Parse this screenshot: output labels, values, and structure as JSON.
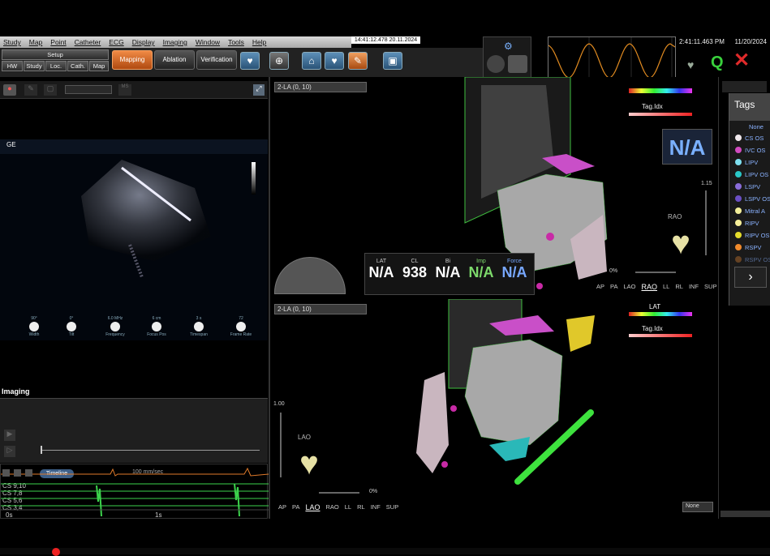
{
  "menu": [
    "Study",
    "Map",
    "Point",
    "Catheter",
    "ECG",
    "Display",
    "Imaging",
    "Window",
    "Tools",
    "Help"
  ],
  "timestamp_top": "14:41:12.478  20.11.2024",
  "clock": {
    "time": "2:41:11.463 PM",
    "date": "11/20/2024"
  },
  "toolbar": {
    "setup": "Setup",
    "sub": [
      "HW",
      "Study",
      "Loc.",
      "Cath.",
      "Map"
    ],
    "modes": [
      "Mapping",
      "Ablation",
      "Verification"
    ]
  },
  "views": {
    "top": {
      "dropdown": "2-LA (0, 10)",
      "orientation_label": "RAO",
      "view_buttons": [
        "AP",
        "PA",
        "LAO",
        "RAO",
        "LL",
        "RL",
        "INF",
        "SUP"
      ],
      "selected": "RAO",
      "percent": "0%",
      "zoom": "1.15",
      "na_display": "N/A",
      "tag_idx": "Tag.Idx"
    },
    "bottom": {
      "dropdown": "2-LA (0, 10)",
      "orientation_label": "LAO",
      "view_buttons": [
        "AP",
        "PA",
        "LAO",
        "RAO",
        "LL",
        "RL",
        "INF",
        "SUP"
      ],
      "selected": "LAO",
      "percent": "0%",
      "zoom": "1.00",
      "lat_label": "LAT",
      "tag_idx": "Tag.Idx",
      "none_select": "None"
    }
  },
  "readout": {
    "headers": [
      "LAT",
      "CL",
      "Bi",
      "Imp",
      "Force"
    ],
    "values": [
      "N/A",
      "938",
      "N/A",
      "N/A",
      "N/A"
    ],
    "colors": [
      "#ffffff",
      "#ffffff",
      "#ffffff",
      "#7dd96b",
      "#78a8ff"
    ]
  },
  "echo": {
    "controls": [
      "Width",
      "Tilt",
      "Frequency",
      "Focus Pos",
      "Timespan",
      "Frame Rate"
    ],
    "values": [
      "90°",
      "0°",
      "6.0 MHz",
      "6 cm",
      "3 s",
      "72"
    ]
  },
  "imaging_label": "Imaging",
  "ecg": {
    "timeline_label": "Timeline",
    "speed": "100 mm/sec",
    "channels": [
      "CS 9,10",
      "CS 7,8",
      "CS 5,6",
      "CS 3,4"
    ],
    "time_start": "0s",
    "time_mid": "1s"
  },
  "tags": {
    "title": "Tags",
    "items": [
      {
        "label": "None",
        "color": ""
      },
      {
        "label": "CS OS",
        "color": "#f0e8ec"
      },
      {
        "label": "IVC OS",
        "color": "#d14bc0"
      },
      {
        "label": "LIPV",
        "color": "#7fe0ef"
      },
      {
        "label": "LIPV OS",
        "color": "#2ac7c7"
      },
      {
        "label": "LSPV",
        "color": "#8a6cd9"
      },
      {
        "label": "LSPV OS",
        "color": "#6b4fc4"
      },
      {
        "label": "Mitral A",
        "color": "#f3ef9a"
      },
      {
        "label": "RIPV",
        "color": "#f7f09a"
      },
      {
        "label": "RIPV OS",
        "color": "#e4dc2c"
      },
      {
        "label": "RSPV",
        "color": "#f08a2c"
      },
      {
        "label": "RSPV OS",
        "color": "#b06a2c"
      }
    ]
  }
}
